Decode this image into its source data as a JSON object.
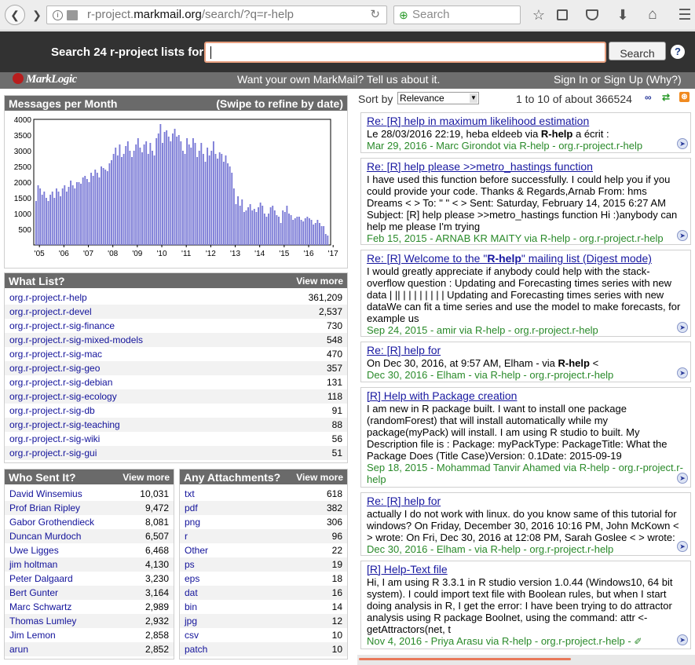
{
  "browser": {
    "url_host": "r-project.",
    "url_domain": "markmail.org",
    "url_path": "/search/?q=r-help",
    "search_placeholder": "Search"
  },
  "header": {
    "search_label": "Search 24 r-project lists for:",
    "search_value": "",
    "search_button": "Search",
    "help": "?",
    "logo": "MarkLogic",
    "promo": "Want your own MarkMail? Tell us about it.",
    "signin": "Sign In or Sign Up (Why?)"
  },
  "chart_box": {
    "title": "Messages per Month",
    "subtitle": "(Swipe to refine by date)"
  },
  "chart_data": {
    "type": "bar",
    "title": "Messages per Month",
    "ylim": [
      0,
      4000
    ],
    "yticks": [
      500,
      1000,
      1500,
      2000,
      2500,
      3000,
      3500,
      4000
    ],
    "xticks": [
      "'05",
      "'06",
      "'07",
      "'08",
      "'09",
      "'10",
      "'11",
      "'12",
      "'13",
      "'14",
      "'15",
      "'16",
      "'17"
    ],
    "start": "2004-11",
    "color": "#7b7bd6",
    "values": [
      1400,
      1900,
      1800,
      1600,
      1700,
      1500,
      1400,
      1600,
      1700,
      1500,
      1800,
      1700,
      1550,
      1800,
      1900,
      1700,
      1850,
      2050,
      1900,
      1800,
      2000,
      2000,
      1950,
      2150,
      2200,
      2100,
      2000,
      2300,
      2200,
      2400,
      2300,
      2150,
      2500,
      2450,
      2400,
      2350,
      2600,
      2700,
      2900,
      3100,
      2850,
      3200,
      2800,
      2900,
      3150,
      3300,
      3000,
      2800,
      3000,
      3200,
      3400,
      3100,
      2950,
      3200,
      3300,
      2900,
      3250,
      3000,
      2850,
      3400,
      3550,
      3850,
      3250,
      3600,
      3650,
      3450,
      3300,
      3550,
      3700,
      3450,
      3500,
      3300,
      3000,
      2900,
      3400,
      3200,
      3100,
      3400,
      3250,
      2800,
      3000,
      3250,
      2900,
      2650,
      3100,
      2850,
      3000,
      3300,
      2900,
      2750,
      2950,
      2900,
      2650,
      2850,
      2600,
      2500,
      2300,
      1800,
      1300,
      1550,
      1250,
      1450,
      1050,
      1100,
      1200,
      1300,
      1100,
      1150,
      1050,
      1200,
      1350,
      1250,
      1000,
      900,
      1000,
      1200,
      1250,
      1100,
      950,
      900,
      700,
      1100,
      1050,
      1250,
      1000,
      950,
      800,
      850,
      900,
      900,
      800,
      750,
      850,
      900,
      850,
      800,
      650,
      700,
      800,
      700,
      600,
      600,
      350,
      300
    ]
  },
  "what_list": {
    "title": "What List?",
    "more": "View more",
    "rows": [
      {
        "name": "org.r-project.r-help",
        "count": "361,209"
      },
      {
        "name": "org.r-project.r-devel",
        "count": "2,537"
      },
      {
        "name": "org.r-project.r-sig-finance",
        "count": "730"
      },
      {
        "name": "org.r-project.r-sig-mixed-models",
        "count": "548"
      },
      {
        "name": "org.r-project.r-sig-mac",
        "count": "470"
      },
      {
        "name": "org.r-project.r-sig-geo",
        "count": "357"
      },
      {
        "name": "org.r-project.r-sig-debian",
        "count": "131"
      },
      {
        "name": "org.r-project.r-sig-ecology",
        "count": "118"
      },
      {
        "name": "org.r-project.r-sig-db",
        "count": "91"
      },
      {
        "name": "org.r-project.r-sig-teaching",
        "count": "88"
      },
      {
        "name": "org.r-project.r-sig-wiki",
        "count": "56"
      },
      {
        "name": "org.r-project.r-sig-gui",
        "count": "51"
      }
    ]
  },
  "who_sent": {
    "title": "Who Sent It?",
    "more": "View more",
    "rows": [
      {
        "name": "David Winsemius",
        "count": "10,031"
      },
      {
        "name": "Prof Brian Ripley",
        "count": "9,472"
      },
      {
        "name": "Gabor Grothendieck",
        "count": "8,081"
      },
      {
        "name": "Duncan Murdoch",
        "count": "6,507"
      },
      {
        "name": "Uwe Ligges",
        "count": "6,468"
      },
      {
        "name": "jim holtman",
        "count": "4,130"
      },
      {
        "name": "Peter Dalgaard",
        "count": "3,230"
      },
      {
        "name": "Bert Gunter",
        "count": "3,164"
      },
      {
        "name": "Marc Schwartz",
        "count": "2,989"
      },
      {
        "name": "Thomas Lumley",
        "count": "2,932"
      },
      {
        "name": "Jim Lemon",
        "count": "2,858"
      },
      {
        "name": "arun",
        "count": "2,852"
      }
    ]
  },
  "attachments": {
    "title": "Any Attachments?",
    "more": "View more",
    "rows": [
      {
        "name": "txt",
        "count": "618"
      },
      {
        "name": "pdf",
        "count": "382"
      },
      {
        "name": "png",
        "count": "306"
      },
      {
        "name": "r",
        "count": "96"
      },
      {
        "name": "Other",
        "count": "22"
      },
      {
        "name": "ps",
        "count": "19"
      },
      {
        "name": "eps",
        "count": "18"
      },
      {
        "name": "dat",
        "count": "16"
      },
      {
        "name": "bin",
        "count": "14"
      },
      {
        "name": "jpg",
        "count": "12"
      },
      {
        "name": "csv",
        "count": "10"
      },
      {
        "name": "patch",
        "count": "10"
      }
    ]
  },
  "results_bar": {
    "sort_label": "Sort by",
    "sort_value": "Relevance",
    "count": "1 to 10 of about 366524"
  },
  "results": [
    {
      "title": "Re: [R] help in maximum likelihood estimation",
      "snippet": "Le 28/03/2016 22:19, heba eldeeb via <b>R-help</b> a écrit :",
      "meta": "Mar 29, 2016 - Marc Girondot via R-help - org.r-project.r-help"
    },
    {
      "title": "Re: [R] help please >>metro_hastings function",
      "snippet": "I have used this function before successfully. I could help you if you could provide your code. Thanks &amp; Regards,Arnab  From: hms Dreams &lt; &gt; To: \" \" &lt; &gt; Sent: Saturday, February 14, 2015 6:27 AM Subject: [R] help please &gt;&gt;metro_hastings function Hi :)anybody can help me please I'm trying",
      "meta": "Feb 15, 2015 - ARNAB KR MAITY via R-help - org.r-project.r-help"
    },
    {
      "title": "Re: [R] Welcome to the \"<b>R-help</b>\" mailing list (Digest mode)",
      "snippet": "I would greatly appreciate if anybody could help with the stack-overflow question : Updating and Forecasting times series with new data |  ||  | |  |  |  |  |  | | Updating and Forecasting times series with new dataWe can fit a time series and use the model to make forecasts, for example us",
      "meta": "Sep 24, 2015 - amir via R-help - org.r-project.r-help"
    },
    {
      "title": "Re: [R] help for",
      "snippet": "On Dec 30, 2016, at 9:57 AM, Elham - via <b>R-help</b> &lt;",
      "meta": "Dec 30, 2016 - Elham - via R-help - org.r-project.r-help"
    },
    {
      "title": "[R] Help with Package creation",
      "snippet": "I am new in R package built.  I want to install one package (randomForest) that will install automatically while my package(myPack) will install. I am using R studio to built.  My Description file is :  Package: myPackType: PackageTitle: What the Package Does (Title Case)Version: 0.1Date: 2015-09-19",
      "meta": "Sep 18, 2015 - Mohammad Tanvir Ahamed via R-help - org.r-project.r-help"
    },
    {
      "title": "Re: [R] help for",
      "snippet": "actually I do not work with linux. do you know same of this tutorial for windows? On Friday, December 30, 2016 10:16 PM, John McKown &lt; &gt; wrote: On Fri, Dec 30, 2016 at 12:08 PM, Sarah Goslee &lt; &gt; wrote:",
      "meta": "Dec 30, 2016 - Elham - via R-help - org.r-project.r-help"
    },
    {
      "title": "[R] Help-Text file",
      "snippet": "Hi,       I am using R 3.3.1 in R studio version 1.0.44 (Windows10, 64 bit system). I could import text file with Boolean rules, but when I start doing analysis in R, I get the error: I have been trying to do attractor analysis using R package Boolnet, using the command: attr &lt;- getAttractors(net, t",
      "meta": "Nov 4, 2016 - Priya Arasu via R-help - org.r-project.r-help - "
    }
  ]
}
